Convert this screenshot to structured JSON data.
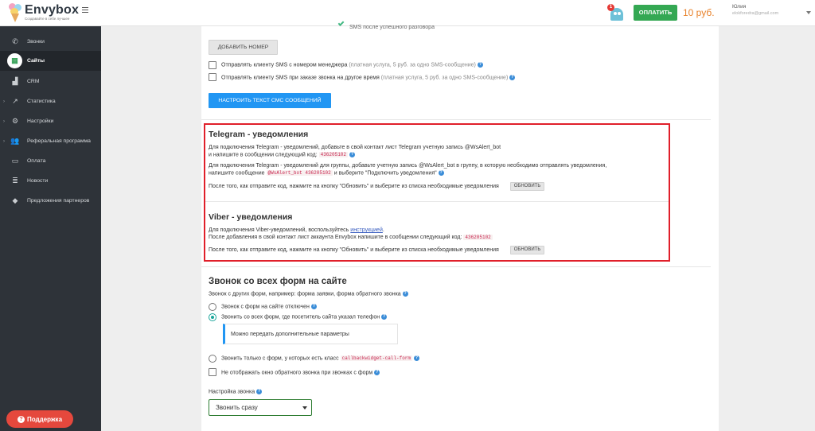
{
  "topbar": {
    "logo_name": "Envybox",
    "logo_tagline": "Создавайте в себе лучшее",
    "notification_count": "1",
    "pay_button": "ОПЛАТИТЬ",
    "balance": "10 руб.",
    "user_name": "Юлия",
    "user_email": "elokforedra@gmail.com"
  },
  "sidebar": {
    "items": [
      {
        "label": "Звонки",
        "icon": "phone-icon"
      },
      {
        "label": "Сайты",
        "icon": "sites-icon"
      },
      {
        "label": "CRM",
        "icon": "crm-icon"
      },
      {
        "label": "Статистика",
        "icon": "chart-icon"
      },
      {
        "label": "Настройки",
        "icon": "gear-icon"
      },
      {
        "label": "Реферальная программа",
        "icon": "users-icon"
      },
      {
        "label": "Оплата",
        "icon": "card-icon"
      },
      {
        "label": "Новости",
        "icon": "news-icon"
      },
      {
        "label": "Предложения партнеров",
        "icon": "tag-icon"
      }
    ],
    "support_button": "Поддержка"
  },
  "sms": {
    "after_call": "SMS после успешного разговора",
    "add_number": "ДОБАВИТЬ НОМЕР",
    "opt1_label": "Отправлять клиенту SMS с номером менеджера",
    "opt1_note": "(платная услуга, 5 руб. за одно SMS-сообщение)",
    "opt2_label": "Отправлять клиенту SMS при заказе звонка на другое время",
    "opt2_note": "(платная услуга, 5 руб. за одно SMS-сообщение)",
    "config_button": "НАСТРОИТЬ ТЕКСТ СМС СООБЩЕНИЙ"
  },
  "telegram": {
    "title": "Telegram - уведомления",
    "p1_line1": "Для подключения Telegram - уведомлений, добавьте в свой контакт лист Telegram учетную запись @WsAlert_bot",
    "p1_line2": "и напишите в сообщении следующий код:",
    "code": "436205102",
    "p2_line1": "Для подключения Telegram - уведомлений для группы, добавьте учетную запись @WsAlert_bot в группу, в которую необходимо отправлять уведомления,",
    "p2_line2_a": "напишите сообщение",
    "group_code": "@WsAlert_bot 436205102",
    "p2_line2_b": "и выберите \"Подключить уведомления\"",
    "after_text": "После того, как отправите код, нажмите на кнопку \"Обновить\" и выберите из списка необходимые уведомления",
    "refresh_button": "ОБНОВИТЬ"
  },
  "viber": {
    "title": "Viber - уведомления",
    "line1_a": "Для подключения Viber-уведомлений, воспользуйтесь",
    "line1_link": "инструкцией",
    "line2": "После добавления в свой контакт лист аккаунта Envybox напишите в сообщении следующий код:",
    "code": "436205102",
    "after_text": "После того, как отправите код, нажмите на кнопку \"Обновить\" и выберите из списка необходимые уведомления",
    "refresh_button": "ОБНОВИТЬ"
  },
  "forms": {
    "title": "Звонок со всех форм на сайте",
    "subtitle": "Звонок с других форм, например: форма заявки, форма обратного звонка",
    "radio1": "Звонок с форм на сайте отключен",
    "radio2": "Звонить со всех форм, где посетитель сайта указал телефон",
    "info": "Можно передать дополнительные параметры",
    "radio3": "Звонить только с форм, у которых есть класс",
    "class_code": "callbackwidget-call-form",
    "checkbox": "Не отображать окно обратного звонка при звонках с форм",
    "setting_label": "Настройка звонка",
    "select_value": "Звонить сразу"
  }
}
